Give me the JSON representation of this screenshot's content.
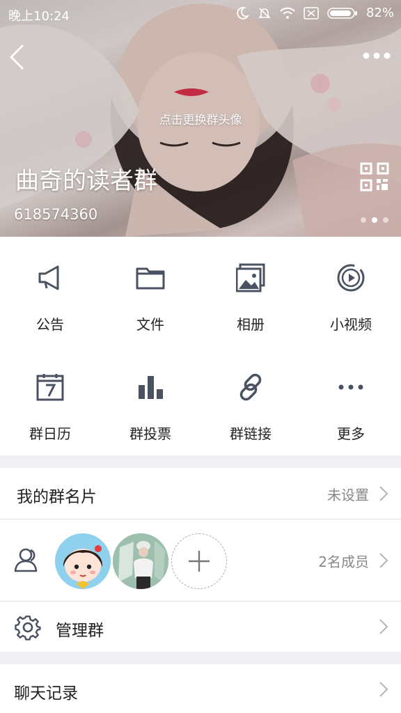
{
  "status_bar": {
    "time": "晚上10:24",
    "battery": "82%"
  },
  "header": {
    "change_avatar_hint": "点击更换群头像",
    "group_name": "曲奇的读者群",
    "group_id": "618574360"
  },
  "features": [
    {
      "label": "公告",
      "icon": "megaphone-icon"
    },
    {
      "label": "文件",
      "icon": "folder-icon"
    },
    {
      "label": "相册",
      "icon": "photo-album-icon"
    },
    {
      "label": "小视频",
      "icon": "video-icon"
    },
    {
      "label": "群日历",
      "icon": "calendar-icon"
    },
    {
      "label": "群投票",
      "icon": "bar-chart-icon"
    },
    {
      "label": "群链接",
      "icon": "link-icon"
    },
    {
      "label": "更多",
      "icon": "more-dots-icon"
    }
  ],
  "my_card": {
    "title": "我的群名片",
    "value": "未设置"
  },
  "members": {
    "count_label": "2名成员"
  },
  "manage": {
    "title": "管理群"
  },
  "chat_history": {
    "title": "聊天记录"
  },
  "colors": {
    "icon": "#4a5160",
    "divider": "#e1e1e6",
    "background": "#efeff4"
  }
}
